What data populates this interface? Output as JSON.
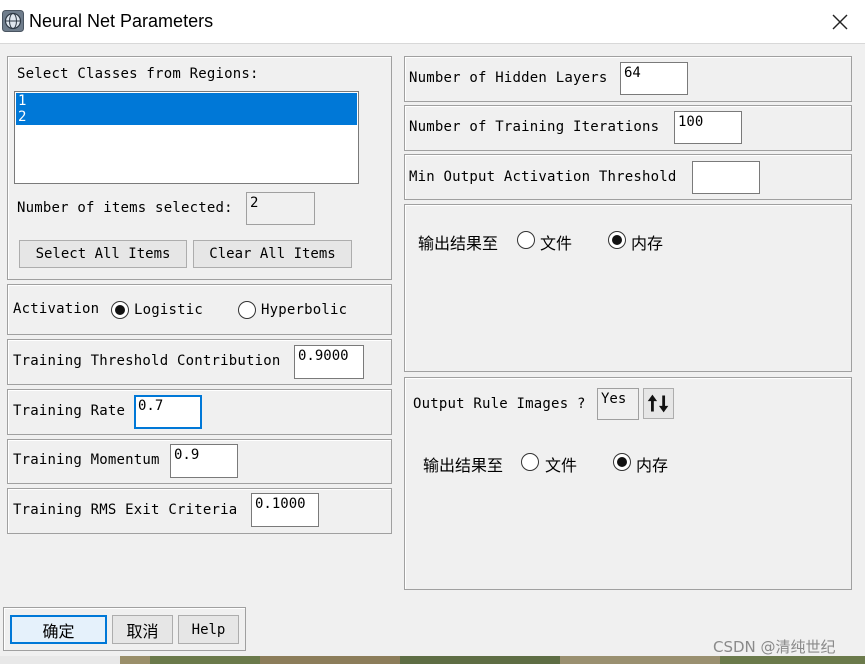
{
  "window": {
    "title": "Neural Net Parameters"
  },
  "classes": {
    "label": "Select Classes from Regions:",
    "items": [
      "1",
      "2"
    ],
    "selected_count_label": "Number of items selected:",
    "selected_count": "2",
    "select_all_label": "Select All Items",
    "clear_all_label": "Clear All Items"
  },
  "activation": {
    "label": "Activation",
    "options": [
      "Logistic",
      "Hyperbolic"
    ],
    "selected": "Logistic"
  },
  "training": {
    "threshold_label": "Training Threshold Contribution",
    "threshold_value": "0.9000",
    "rate_label": "Training Rate",
    "rate_value": "0.7",
    "momentum_label": "Training Momentum",
    "momentum_value": "0.9",
    "rms_label": "Training RMS Exit Criteria",
    "rms_value": "0.1000"
  },
  "network": {
    "hidden_layers_label": "Number of Hidden Layers",
    "hidden_layers_value": "64",
    "iterations_label": "Number of Training Iterations",
    "iterations_value": "100",
    "min_activation_label": "Min Output Activation Threshold",
    "min_activation_value": ""
  },
  "output_class": {
    "label": "输出结果至",
    "file_label": "文件",
    "memory_label": "内存",
    "selected": "memory"
  },
  "output_rule": {
    "label": "Output Rule Images ?",
    "value": "Yes",
    "dest_label": "输出结果至",
    "file_label": "文件",
    "memory_label": "内存",
    "selected": "memory"
  },
  "buttons": {
    "ok": "确定",
    "cancel": "取消",
    "help": "Help"
  },
  "watermark": "CSDN @清纯世纪",
  "icons": {
    "app": "envi-globe-icon",
    "close": "close-icon",
    "toggle": "sort-arrows-icon"
  },
  "colors": {
    "selection": "#0078d7",
    "dialog_bg": "#f0f0f0"
  }
}
